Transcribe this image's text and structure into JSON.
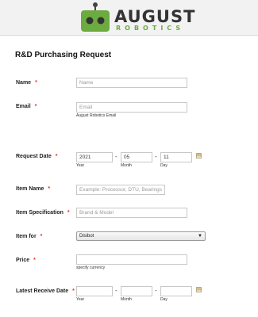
{
  "brand": {
    "word": "AUGUST",
    "sub": "ROBOTICS",
    "color_green": "#6cab3f"
  },
  "form": {
    "title": "R&D Purchasing Request",
    "required_mark": "*",
    "name": {
      "label": "Name",
      "placeholder": "Name",
      "value": ""
    },
    "email": {
      "label": "Email",
      "placeholder": "Email",
      "value": "",
      "sublabel": "August Robotics Email"
    },
    "request_date": {
      "label": "Request Date",
      "year": "2021",
      "month": "05",
      "day": "11",
      "year_label": "Year",
      "month_label": "Month",
      "day_label": "Day",
      "separator": "-",
      "icon": "calendar-icon"
    },
    "item_name": {
      "label": "Item Name",
      "placeholder": "Example: Processor, DTU, Bearings",
      "value": ""
    },
    "item_spec": {
      "label": "Item Specification",
      "placeholder": "Brand & Model",
      "value": ""
    },
    "item_for": {
      "label": "Item for",
      "selected": "Disibot",
      "arrow": "▼"
    },
    "price": {
      "label": "Price",
      "value": "",
      "sublabel": "specify currency"
    },
    "latest_receive": {
      "label": "Latest Receive Date",
      "year": "",
      "month": "",
      "day": "",
      "year_label": "Year",
      "month_label": "Month",
      "day_label": "Day",
      "separator": "-",
      "icon": "calendar-icon"
    }
  }
}
